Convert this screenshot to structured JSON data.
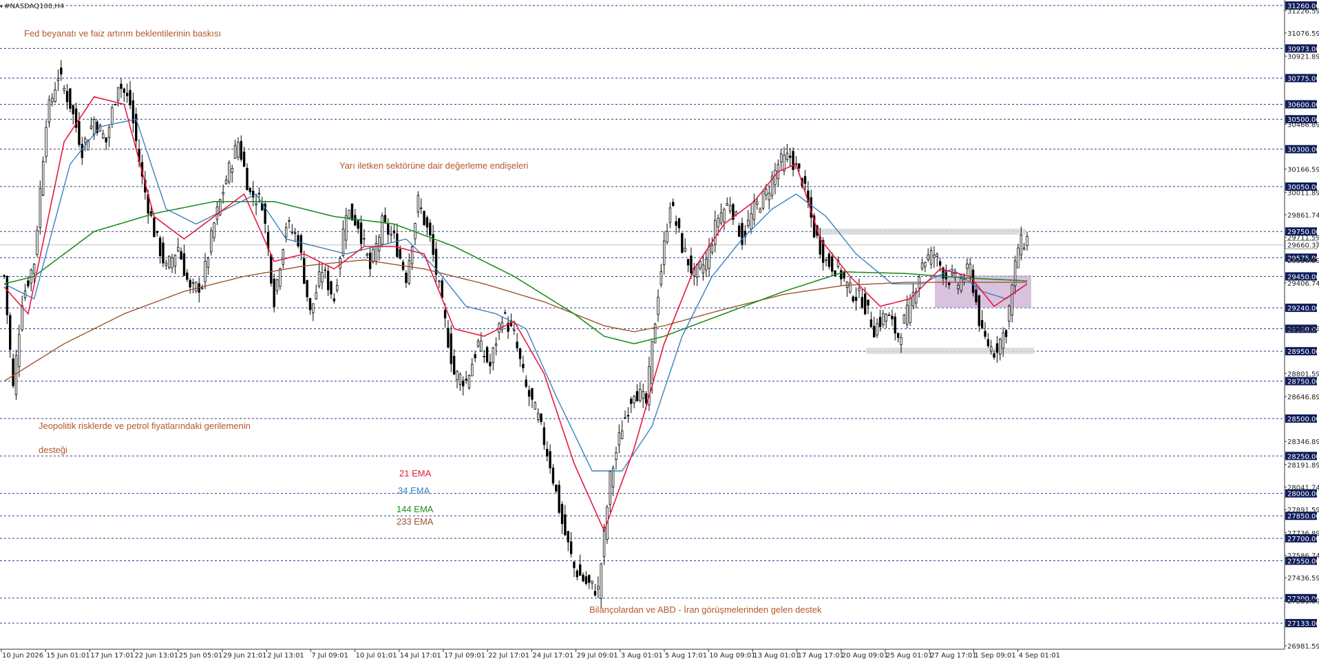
{
  "symbol": "#NASDAQ100,H4",
  "colors": {
    "background": "#ffffff",
    "grid_dash": "#2b3a8c",
    "candle": "#000000",
    "ema21": "#e8183c",
    "ema34": "#3a7fc0",
    "ema144": "#1e8e1e",
    "ema233": "#a0522d",
    "annotation": "#b5562a",
    "box_purple": "#c8a8d0",
    "box_grey": "#d8d8dc",
    "price_label_bg": "#0f1d5a"
  },
  "annotations": {
    "fed": "Fed beyanatı ve faiz artırım beklentilerinin baskısı",
    "semis": "Yarı iletken sektörüne dair değerleme endişeleri",
    "geo1": "Jeopolitik risklerde ve petrol fiyatlarındaki gerilemenin",
    "geo2": "desteği",
    "earnings": "Bilançolardan ve ABD - İran görüşmelerinden gelen destek"
  },
  "legend": {
    "ema21": "21 EMA",
    "ema34": "34 EMA",
    "ema144": "144 EMA",
    "ema233": "233 EMA"
  },
  "chart_data": {
    "type": "candlestick",
    "title": "#NASDAQ100,H4",
    "ylim": [
      26981.59,
      31260.0
    ],
    "y_ticks": [
      "31226.59",
      "31076.59",
      "30921.89",
      "30466.89",
      "30166.59",
      "30011.89",
      "29861.74",
      "29711.59",
      "29556.89",
      "29406.74",
      "29101.59",
      "28801.59",
      "28646.89",
      "28346.89",
      "28191.89",
      "28041.74",
      "27891.59",
      "27736.89",
      "27586.74",
      "27436.59",
      "27281.89",
      "26981.59"
    ],
    "levels": [
      31260.0,
      30973.0,
      30775.0,
      30600.0,
      30500.0,
      30300.0,
      30050.0,
      29750.0,
      29575.0,
      29450.0,
      29240.0,
      29100.0,
      28950.0,
      28750.0,
      28500.0,
      28250.0,
      28000.0,
      27850.0,
      27700.0,
      27550.0,
      27300.0,
      27133.0
    ],
    "level_labels": [
      "31260.00",
      "30973.00",
      "30775.00",
      "30600.00",
      "30500.00",
      "30300.00",
      "30050.00",
      "29750.00",
      "29575.00",
      "29450.00",
      "29240.00",
      "29100.00",
      "28950.00",
      "28750.00",
      "28500.00",
      "28250.00",
      "28000.00",
      "27850.00",
      "27700.00",
      "27550.00",
      "27300.00",
      "27133.00"
    ],
    "current_price": 29660.37,
    "current_price_label": "29660.37",
    "x_labels": [
      "10 Jun 2026",
      "15 Jun 01:01",
      "17 Jun 17:01",
      "22 Jun 13:01",
      "25 Jun 05:01",
      "29 Jun 21:01",
      "2 Jul 13:01",
      "7 Jul 09:01",
      "10 Jul 01:01",
      "14 Jul 17:01",
      "17 Jul 09:01",
      "22 Jul 17:01",
      "24 Jul 17:01",
      "29 Jul 09:01",
      "3 Aug 01:01",
      "5 Aug 17:01",
      "10 Aug 09:01",
      "13 Aug 01:01",
      "17 Aug 17:01",
      "20 Aug 09:01",
      "25 Aug 01:01",
      "27 Aug 17:01",
      "1 Sep 09:01",
      "4 Sep 01:01"
    ],
    "close_anchors": [
      [
        0,
        29450
      ],
      [
        3,
        28700
      ],
      [
        6,
        29300
      ],
      [
        10,
        29550
      ],
      [
        14,
        30500
      ],
      [
        18,
        30800
      ],
      [
        22,
        30600
      ],
      [
        26,
        30300
      ],
      [
        30,
        30500
      ],
      [
        34,
        30350
      ],
      [
        38,
        30750
      ],
      [
        42,
        30600
      ],
      [
        46,
        30100
      ],
      [
        50,
        29750
      ],
      [
        54,
        29500
      ],
      [
        58,
        29650
      ],
      [
        62,
        29350
      ],
      [
        66,
        29400
      ],
      [
        70,
        29800
      ],
      [
        74,
        30100
      ],
      [
        78,
        30350
      ],
      [
        82,
        30000
      ],
      [
        86,
        29950
      ],
      [
        90,
        29300
      ],
      [
        94,
        29800
      ],
      [
        98,
        29700
      ],
      [
        102,
        29200
      ],
      [
        106,
        29500
      ],
      [
        110,
        29300
      ],
      [
        114,
        29900
      ],
      [
        118,
        29800
      ],
      [
        122,
        29500
      ],
      [
        126,
        29800
      ],
      [
        130,
        29700
      ],
      [
        134,
        29450
      ],
      [
        138,
        29950
      ],
      [
        142,
        29700
      ],
      [
        146,
        29250
      ],
      [
        150,
        28800
      ],
      [
        154,
        28750
      ],
      [
        158,
        29000
      ],
      [
        162,
        28850
      ],
      [
        166,
        29200
      ],
      [
        170,
        29050
      ],
      [
        174,
        28700
      ],
      [
        178,
        28500
      ],
      [
        182,
        28200
      ],
      [
        186,
        27800
      ],
      [
        190,
        27500
      ],
      [
        194,
        27400
      ],
      [
        198,
        27350
      ],
      [
        202,
        28100
      ],
      [
        206,
        28450
      ],
      [
        210,
        28700
      ],
      [
        214,
        28600
      ],
      [
        218,
        29350
      ],
      [
        222,
        29950
      ],
      [
        226,
        29650
      ],
      [
        230,
        29450
      ],
      [
        234,
        29550
      ],
      [
        238,
        29850
      ],
      [
        242,
        29950
      ],
      [
        246,
        29700
      ],
      [
        250,
        29900
      ],
      [
        254,
        30000
      ],
      [
        258,
        30200
      ],
      [
        262,
        30250
      ],
      [
        266,
        30100
      ],
      [
        270,
        29750
      ],
      [
        274,
        29550
      ],
      [
        278,
        29500
      ],
      [
        282,
        29350
      ],
      [
        286,
        29300
      ],
      [
        290,
        29100
      ],
      [
        294,
        29200
      ],
      [
        298,
        29050
      ],
      [
        302,
        29250
      ],
      [
        306,
        29550
      ],
      [
        310,
        29600
      ],
      [
        314,
        29450
      ],
      [
        318,
        29400
      ],
      [
        322,
        29500
      ],
      [
        326,
        29050
      ],
      [
        330,
        28950
      ],
      [
        334,
        29100
      ],
      [
        338,
        29650
      ],
      [
        341,
        29700
      ]
    ],
    "ema_anchors": {
      "ema21": [
        [
          0,
          29380
        ],
        [
          8,
          29200
        ],
        [
          20,
          30350
        ],
        [
          30,
          30650
        ],
        [
          40,
          30600
        ],
        [
          50,
          29850
        ],
        [
          60,
          29700
        ],
        [
          70,
          29850
        ],
        [
          80,
          30000
        ],
        [
          90,
          29550
        ],
        [
          100,
          29600
        ],
        [
          110,
          29500
        ],
        [
          120,
          29650
        ],
        [
          130,
          29650
        ],
        [
          140,
          29600
        ],
        [
          150,
          29100
        ],
        [
          160,
          29050
        ],
        [
          170,
          29150
        ],
        [
          180,
          28800
        ],
        [
          190,
          28200
        ],
        [
          200,
          27750
        ],
        [
          210,
          28300
        ],
        [
          220,
          29000
        ],
        [
          230,
          29500
        ],
        [
          240,
          29800
        ],
        [
          250,
          29950
        ],
        [
          258,
          30150
        ],
        [
          264,
          30200
        ],
        [
          272,
          29700
        ],
        [
          282,
          29450
        ],
        [
          292,
          29250
        ],
        [
          302,
          29300
        ],
        [
          312,
          29500
        ],
        [
          322,
          29450
        ],
        [
          330,
          29250
        ],
        [
          341,
          29400
        ]
      ],
      "ema34": [
        [
          0,
          29400
        ],
        [
          10,
          29300
        ],
        [
          22,
          30200
        ],
        [
          32,
          30450
        ],
        [
          44,
          30500
        ],
        [
          54,
          29900
        ],
        [
          64,
          29800
        ],
        [
          74,
          29900
        ],
        [
          84,
          30000
        ],
        [
          94,
          29700
        ],
        [
          104,
          29650
        ],
        [
          114,
          29600
        ],
        [
          124,
          29650
        ],
        [
          134,
          29700
        ],
        [
          144,
          29500
        ],
        [
          154,
          29250
        ],
        [
          164,
          29200
        ],
        [
          174,
          29100
        ],
        [
          184,
          28650
        ],
        [
          196,
          28150
        ],
        [
          206,
          28150
        ],
        [
          216,
          28450
        ],
        [
          226,
          29050
        ],
        [
          236,
          29450
        ],
        [
          246,
          29700
        ],
        [
          256,
          29900
        ],
        [
          264,
          30000
        ],
        [
          274,
          29850
        ],
        [
          284,
          29600
        ],
        [
          296,
          29400
        ],
        [
          306,
          29400
        ],
        [
          316,
          29500
        ],
        [
          326,
          29350
        ],
        [
          334,
          29300
        ],
        [
          341,
          29400
        ]
      ],
      "ema144": [
        [
          0,
          29400
        ],
        [
          10,
          29450
        ],
        [
          30,
          29750
        ],
        [
          50,
          29870
        ],
        [
          70,
          29950
        ],
        [
          90,
          29950
        ],
        [
          110,
          29850
        ],
        [
          130,
          29800
        ],
        [
          150,
          29650
        ],
        [
          170,
          29450
        ],
        [
          190,
          29200
        ],
        [
          200,
          29050
        ],
        [
          210,
          29000
        ],
        [
          220,
          29050
        ],
        [
          240,
          29200
        ],
        [
          260,
          29350
        ],
        [
          280,
          29480
        ],
        [
          300,
          29470
        ],
        [
          320,
          29440
        ],
        [
          341,
          29420
        ]
      ],
      "ema233": [
        [
          0,
          28750
        ],
        [
          20,
          29000
        ],
        [
          40,
          29200
        ],
        [
          60,
          29350
        ],
        [
          80,
          29450
        ],
        [
          100,
          29520
        ],
        [
          120,
          29560
        ],
        [
          140,
          29500
        ],
        [
          160,
          29400
        ],
        [
          180,
          29280
        ],
        [
          200,
          29120
        ],
        [
          210,
          29080
        ],
        [
          220,
          29120
        ],
        [
          240,
          29230
        ],
        [
          260,
          29330
        ],
        [
          280,
          29390
        ],
        [
          300,
          29410
        ],
        [
          320,
          29410
        ],
        [
          341,
          29410
        ]
      ]
    }
  }
}
